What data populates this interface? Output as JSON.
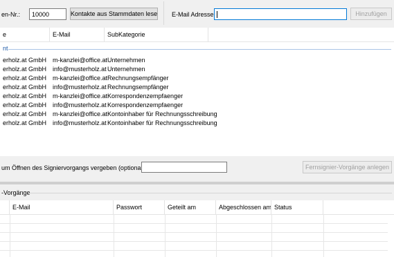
{
  "toolbar": {
    "customer_no_label": "en-Nr.:",
    "customer_no_value": "10000",
    "read_contacts_label": "Kontakte aus Stammdaten lesen",
    "email_label": "E-Mail Adresse:",
    "email_value": "",
    "add_label": "Hinzufügen"
  },
  "contacts": {
    "columns": [
      "e",
      "E-Mail",
      "SubKategorie"
    ],
    "group_label": "nt",
    "rows": [
      [
        "erholz.at GmbH",
        "m-kanzlei@office.at",
        "Unternehmen"
      ],
      [
        "erholz.at GmbH",
        "info@musterholz.at",
        "Unternehmen"
      ],
      [
        "erholz.at GmbH",
        "m-kanzlei@office.at",
        "Rechnungsempfänger"
      ],
      [
        "erholz.at GmbH",
        "info@musterholz.at",
        "Rechnungsempfänger"
      ],
      [
        "erholz.at GmbH",
        "m-kanzlei@office.at",
        "Korrespondenzempfaenger"
      ],
      [
        "erholz.at GmbH",
        "info@musterholz.at",
        "Korrespondenzempfaenger"
      ],
      [
        "erholz.at GmbH",
        "m-kanzlei@office.at",
        "Kontoinhaber für Rechnungsschreibung"
      ],
      [
        "erholz.at GmbH",
        "info@musterholz.at",
        "Kontoinhaber für Rechnungsschreibung"
      ]
    ]
  },
  "signing": {
    "password_label": "um Öffnen des Signiervorgangs vergeben (optional):",
    "password_value": "",
    "create_label": "Fernsignier-Vorgänge anlegen"
  },
  "processes": {
    "group_label": "-Vorgänge",
    "columns": [
      "E-Mail",
      "Passwort",
      "Geteilt am",
      "Abgeschlossen am",
      "Status"
    ]
  }
}
